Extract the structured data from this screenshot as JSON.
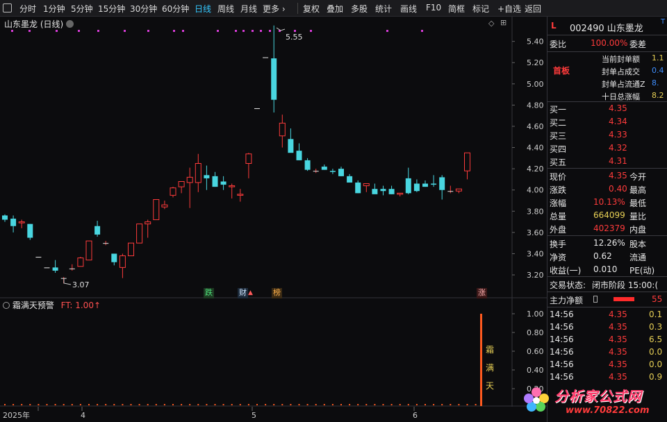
{
  "toolbar": {
    "items": [
      "分时",
      "1分钟",
      "5分钟",
      "15分钟",
      "30分钟",
      "60分钟",
      "日线",
      "周线",
      "月线",
      "更多 ›",
      "复权",
      "叠加",
      "多股",
      "统计",
      "画线",
      "F10",
      "简框",
      "标记",
      "+自选",
      "返回"
    ],
    "active_index": 6
  },
  "chart": {
    "title": "山东墨龙 (日线)",
    "price_axis": [
      "5.40",
      "5.20",
      "5.00",
      "4.80",
      "4.60",
      "4.40",
      "4.20",
      "4.00",
      "3.80",
      "3.60",
      "3.40",
      "3.20"
    ],
    "high_label": "5.55",
    "low_label": "3.07",
    "event_badges": [
      "跌",
      "财",
      "榜",
      "涨"
    ],
    "x_labels": [
      "2025年",
      "4",
      "5",
      "6"
    ]
  },
  "chart_data": {
    "type": "candlestick",
    "title": "山东墨龙 (日线)",
    "ylim": [
      3.05,
      5.62
    ],
    "y_ticks": [
      3.2,
      3.4,
      3.6,
      3.8,
      4.0,
      4.2,
      4.4,
      4.6,
      4.8,
      5.0,
      5.2,
      5.4
    ],
    "high": 5.55,
    "low": 3.07,
    "ohlc": [
      [
        3.76,
        3.77,
        3.7,
        3.72
      ],
      [
        3.73,
        3.76,
        3.6,
        3.66
      ],
      [
        3.69,
        3.72,
        3.64,
        3.7
      ],
      [
        3.68,
        3.68,
        3.53,
        3.55
      ],
      [
        3.37,
        3.37,
        3.37,
        3.37
      ],
      [
        3.27,
        3.27,
        3.27,
        3.27
      ],
      [
        3.27,
        3.34,
        3.22,
        3.24
      ],
      [
        3.17,
        3.18,
        3.12,
        3.17
      ],
      [
        3.26,
        3.3,
        3.24,
        3.26
      ],
      [
        3.28,
        3.37,
        3.28,
        3.36
      ],
      [
        3.34,
        3.52,
        3.34,
        3.52
      ],
      [
        3.66,
        3.71,
        3.56,
        3.58
      ],
      [
        3.5,
        3.52,
        3.48,
        3.5
      ],
      [
        3.4,
        3.4,
        3.29,
        3.32
      ],
      [
        3.27,
        3.4,
        3.17,
        3.38
      ],
      [
        3.38,
        3.5,
        3.38,
        3.5
      ],
      [
        3.5,
        3.62,
        3.5,
        3.68
      ],
      [
        3.68,
        3.72,
        3.55,
        3.7
      ],
      [
        3.72,
        3.91,
        3.72,
        3.91
      ],
      [
        3.84,
        3.9,
        3.82,
        3.86
      ],
      [
        3.95,
        4.03,
        3.93,
        4.02
      ],
      [
        4.03,
        4.08,
        3.97,
        4.08
      ],
      [
        4.07,
        4.21,
        3.83,
        4.12
      ],
      [
        4.07,
        4.34,
        3.98,
        4.25
      ],
      [
        4.14,
        4.23,
        4.0,
        4.11
      ],
      [
        4.13,
        4.17,
        4.03,
        4.03
      ],
      [
        4.08,
        4.13,
        4.0,
        4.05
      ],
      [
        4.03,
        4.06,
        3.92,
        4.04
      ],
      [
        3.95,
        4.01,
        3.89,
        3.96
      ],
      [
        4.25,
        4.35,
        4.11,
        4.34
      ],
      [
        4.77,
        4.77,
        4.77,
        4.77
      ],
      [
        5.25,
        5.25,
        5.25,
        5.25
      ],
      [
        5.24,
        5.55,
        4.73,
        4.85
      ],
      [
        4.51,
        4.71,
        4.4,
        4.63
      ],
      [
        4.48,
        4.58,
        4.37,
        4.35
      ],
      [
        4.37,
        4.44,
        4.28,
        4.28
      ],
      [
        4.28,
        4.3,
        4.18,
        4.19
      ],
      [
        4.18,
        4.2,
        4.16,
        4.18
      ],
      [
        4.22,
        4.24,
        4.19,
        4.19
      ],
      [
        4.18,
        4.2,
        4.15,
        4.17
      ],
      [
        4.2,
        4.22,
        4.13,
        4.13
      ],
      [
        4.13,
        4.15,
        4.08,
        4.07
      ],
      [
        4.07,
        4.09,
        3.97,
        3.97
      ],
      [
        4.04,
        4.06,
        3.98,
        4.06
      ],
      [
        4.01,
        4.06,
        3.97,
        3.96
      ],
      [
        4.01,
        4.04,
        3.95,
        3.99
      ],
      [
        4.01,
        4.04,
        3.96,
        3.96
      ],
      [
        3.96,
        3.97,
        3.94,
        3.97
      ],
      [
        4.11,
        4.21,
        3.96,
        3.97
      ],
      [
        4.06,
        4.1,
        3.98,
        3.99
      ],
      [
        4.06,
        4.09,
        4.03,
        4.03
      ],
      [
        4.06,
        4.14,
        4.03,
        4.05
      ],
      [
        4.12,
        4.14,
        3.91,
        4.0
      ],
      [
        3.99,
        4.04,
        3.97,
        3.99
      ],
      [
        3.99,
        4.01,
        3.97,
        4.01
      ],
      [
        4.18,
        4.35,
        4.1,
        4.35
      ]
    ]
  },
  "indicator": {
    "name": "霜满天预警",
    "ft_label": "FT: 1.00",
    "axis": [
      "1.00",
      "0.80",
      "0.60",
      "0.40",
      "0.20"
    ],
    "signal_chars": [
      "霜",
      "满",
      "天"
    ]
  },
  "right_panel": {
    "code_name": "002490 山东墨龙",
    "l_badge": "L",
    "t_badge": "T",
    "weibi_label": "委比",
    "weibi_value": "100.00%",
    "weicha_label": "委差",
    "first_board": "首板",
    "seal_rows": [
      {
        "label": "当前封单额",
        "value": "1.1"
      },
      {
        "label": "封单占成交",
        "value": "0.4"
      },
      {
        "label": "封单占流通Z",
        "value": "8."
      },
      {
        "label": "十日总涨幅",
        "value": "8.2"
      }
    ],
    "buy_book": [
      {
        "label": "买一",
        "price": "4.35"
      },
      {
        "label": "买二",
        "price": "4.34"
      },
      {
        "label": "买三",
        "price": "4.33"
      },
      {
        "label": "买四",
        "price": "4.32"
      },
      {
        "label": "买五",
        "price": "4.31"
      }
    ],
    "quote": [
      {
        "l": "现价",
        "v": "4.35",
        "r": "今开"
      },
      {
        "l": "涨跌",
        "v": "0.40",
        "r": "最高"
      },
      {
        "l": "涨幅",
        "v": "10.13%",
        "r": "最低"
      },
      {
        "l": "总量",
        "v": "664099",
        "r": "量比"
      },
      {
        "l": "外盘",
        "v": "402379",
        "r": "内盘"
      }
    ],
    "stats": [
      {
        "l": "换手",
        "v": "12.26%",
        "r": "股本"
      },
      {
        "l": "净资",
        "v": "0.62",
        "r": "流通"
      },
      {
        "l": "收益(一)",
        "v": "0.010",
        "r": "PE(动)"
      }
    ],
    "trade_status_label": "交易状态:",
    "trade_status_value": "闭市阶段 15:00:(",
    "main_net_label": "主力净额",
    "main_net_value": "55",
    "ticks": [
      {
        "t": "14:56",
        "p": "4.35",
        "v": "0.1"
      },
      {
        "t": "14:56",
        "p": "4.35",
        "v": "0.3"
      },
      {
        "t": "14:56",
        "p": "4.35",
        "v": "6.5"
      },
      {
        "t": "14:56",
        "p": "4.35",
        "v": "0.0"
      },
      {
        "t": "14:56",
        "p": "4.35",
        "v": "0.0"
      },
      {
        "t": "14:56",
        "p": "4.35",
        "v": "0.9"
      }
    ]
  },
  "watermark": {
    "text": "分析家公式网",
    "url": "www.70822.com"
  }
}
